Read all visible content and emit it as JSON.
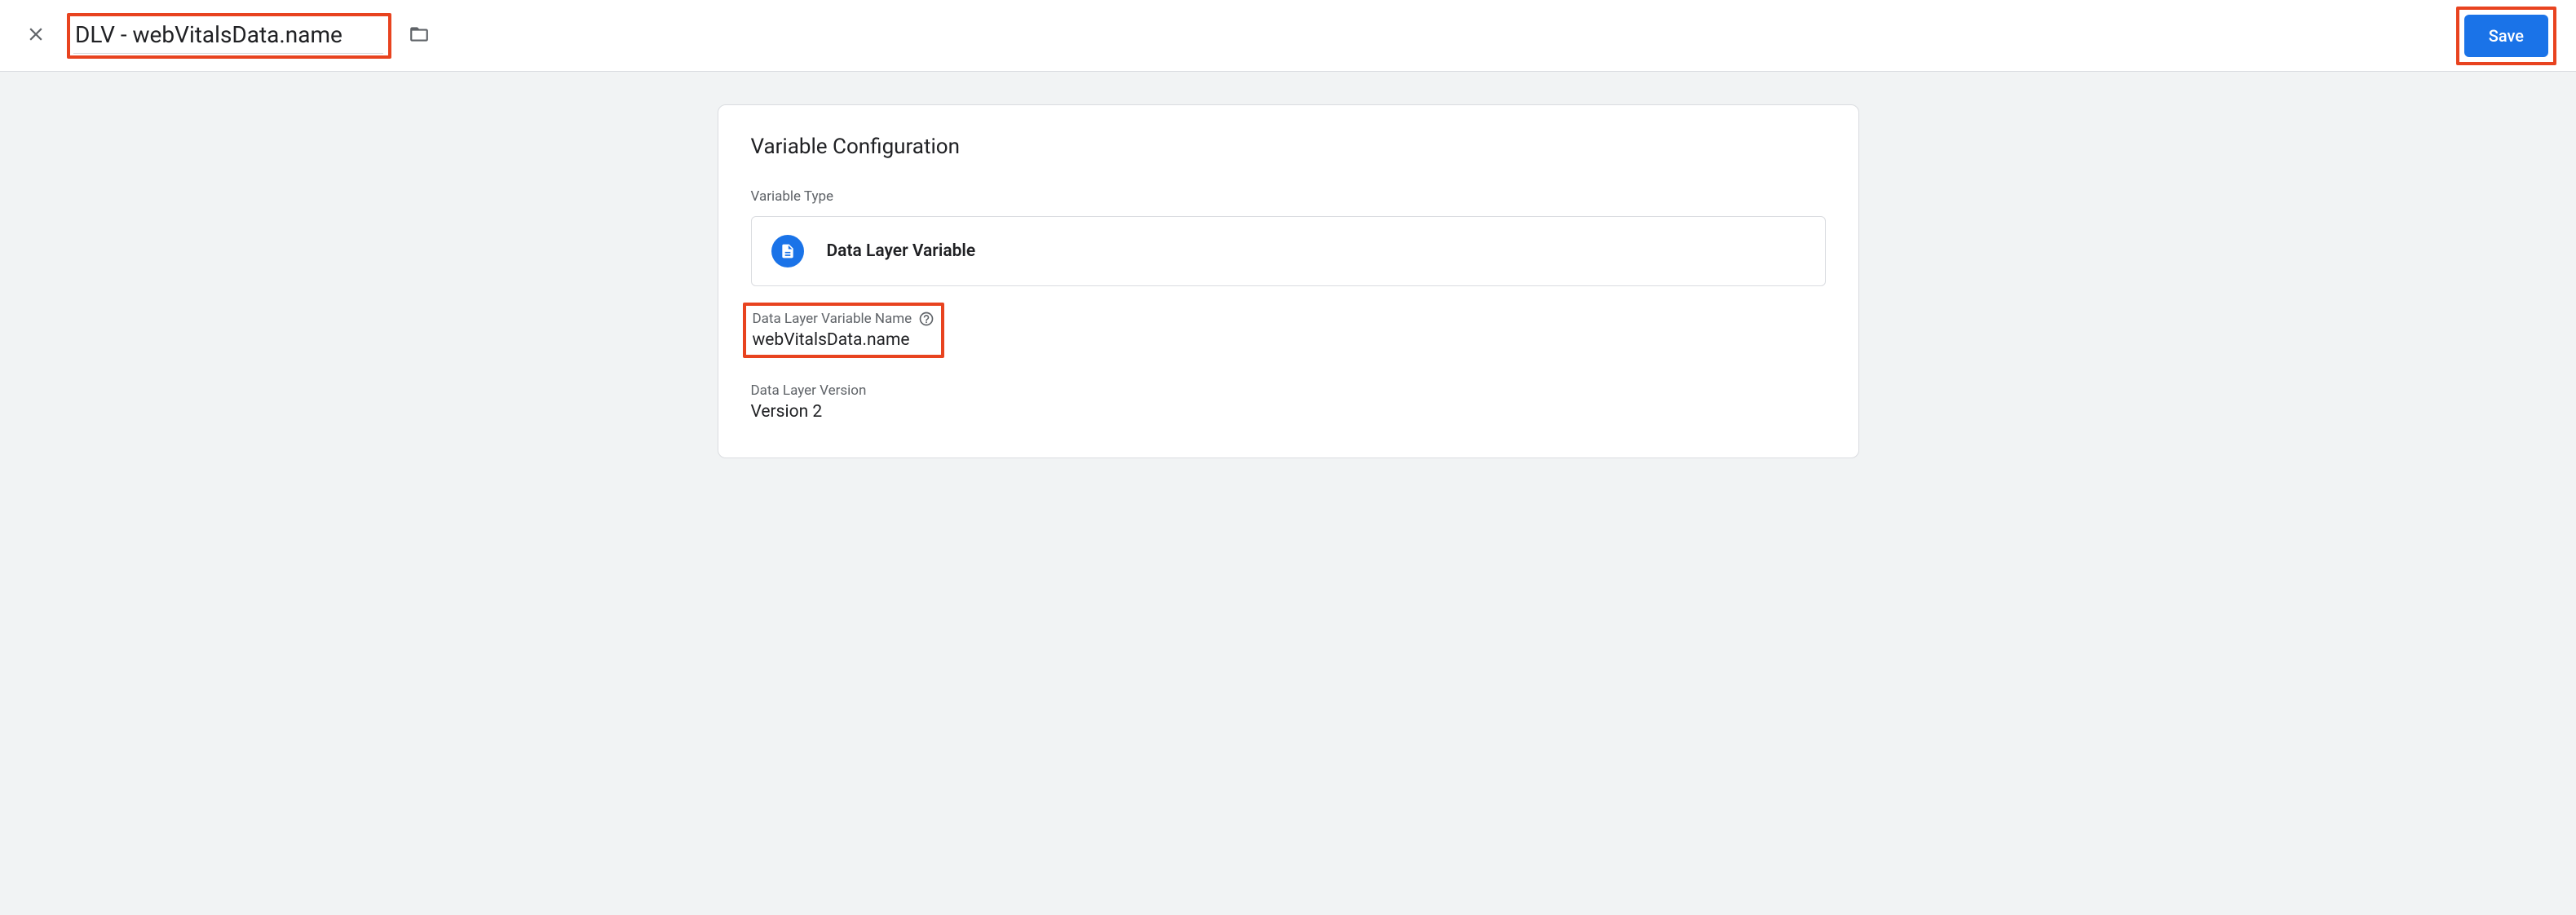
{
  "header": {
    "variable_name": "DLV - webVitalsData.name",
    "save_label": "Save"
  },
  "config": {
    "section_title": "Variable Configuration",
    "type_label": "Variable Type",
    "type_value": "Data Layer Variable",
    "dlv_name_label": "Data Layer Variable Name",
    "dlv_name_value": "webVitalsData.name",
    "version_label": "Data Layer Version",
    "version_value": "Version 2"
  }
}
